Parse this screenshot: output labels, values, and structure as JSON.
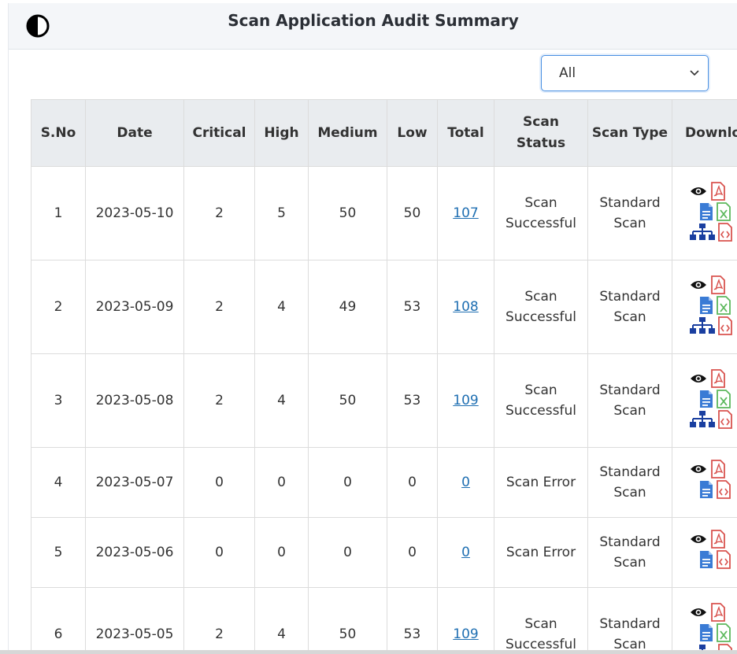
{
  "header": {
    "title": "Scan Application Audit Summary"
  },
  "filter": {
    "selected": "All"
  },
  "table": {
    "headers": {
      "sno": "S.No",
      "date": "Date",
      "critical": "Critical",
      "high": "High",
      "medium": "Medium",
      "low": "Low",
      "total": "Total",
      "scan_status": "Scan Status",
      "scan_type": "Scan Type",
      "download": "Download"
    },
    "rows": [
      {
        "sno": "1",
        "date": "2023-05-10",
        "critical": "2",
        "high": "5",
        "medium": "50",
        "low": "50",
        "total": "107",
        "status": "Scan Successful",
        "type": "Standard Scan"
      },
      {
        "sno": "2",
        "date": "2023-05-09",
        "critical": "2",
        "high": "4",
        "medium": "49",
        "low": "53",
        "total": "108",
        "status": "Scan Successful",
        "type": "Standard Scan"
      },
      {
        "sno": "3",
        "date": "2023-05-08",
        "critical": "2",
        "high": "4",
        "medium": "50",
        "low": "53",
        "total": "109",
        "status": "Scan Successful",
        "type": "Standard Scan"
      },
      {
        "sno": "4",
        "date": "2023-05-07",
        "critical": "0",
        "high": "0",
        "medium": "0",
        "low": "0",
        "total": "0",
        "status": "Scan Error",
        "type": "Standard Scan"
      },
      {
        "sno": "5",
        "date": "2023-05-06",
        "critical": "0",
        "high": "0",
        "medium": "0",
        "low": "0",
        "total": "0",
        "status": "Scan Error",
        "type": "Standard Scan"
      },
      {
        "sno": "6",
        "date": "2023-05-05",
        "critical": "2",
        "high": "4",
        "medium": "50",
        "low": "53",
        "total": "109",
        "status": "Scan Successful",
        "type": "Standard Scan"
      }
    ]
  },
  "colors": {
    "link": "#1f6fb2",
    "pdf": "#d9534f",
    "excel": "#5cb85c",
    "doc": "#3a7bd5",
    "sitemap": "#1a3fa0"
  }
}
